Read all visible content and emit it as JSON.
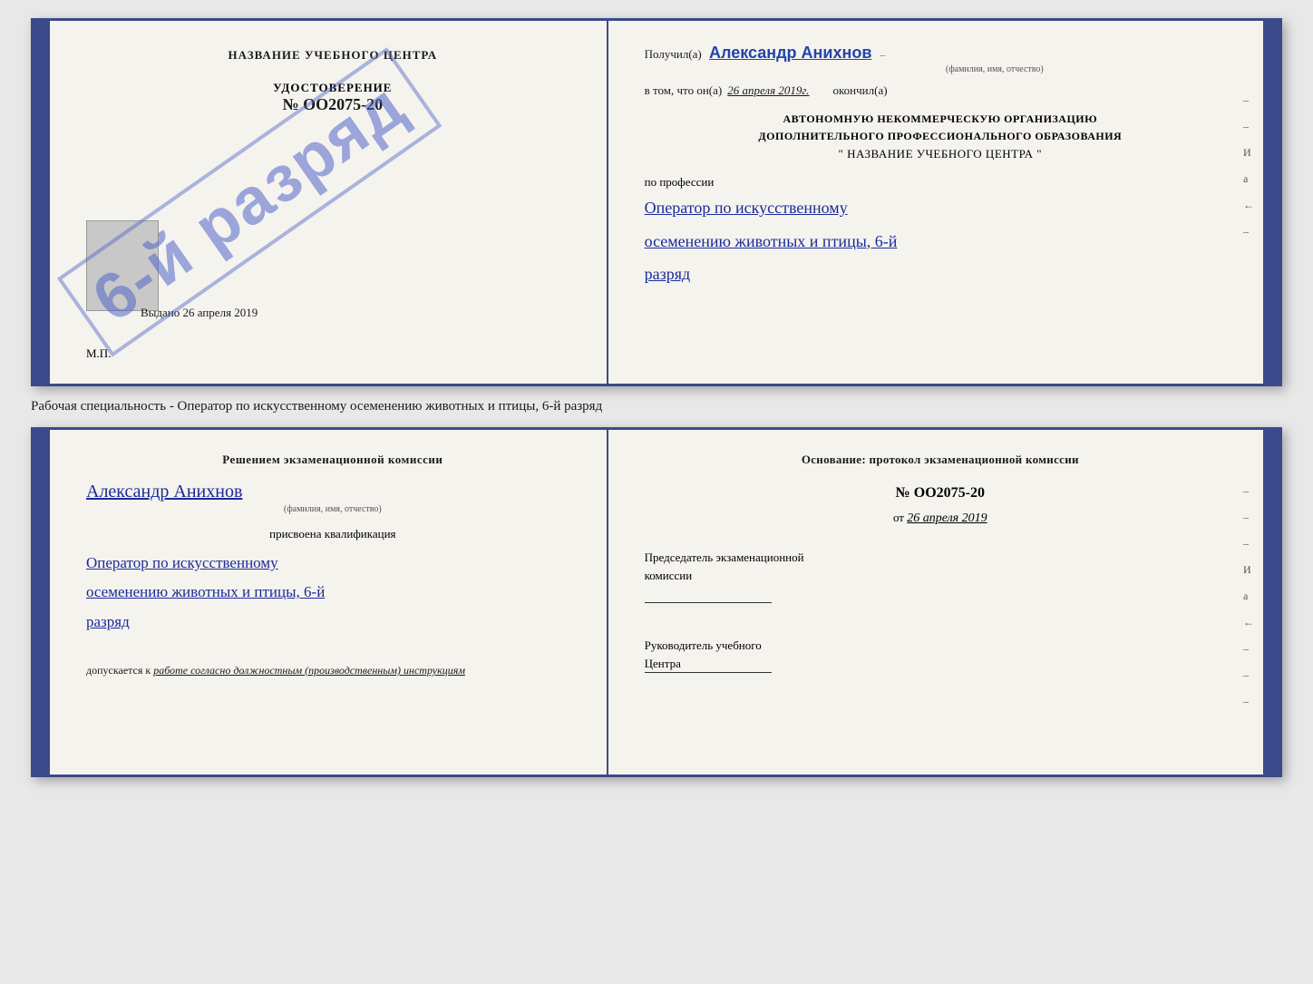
{
  "page": {
    "background": "#e8e8e8"
  },
  "top_cert": {
    "left": {
      "title": "НАЗВАНИЕ УЧЕБНОГО ЦЕНТРА",
      "udostoverenie_label": "УДОСТОВЕРЕНИЕ",
      "cert_number": "№ OO2075-20",
      "stamp_text": "6-й разряд",
      "issued_label": "Выдано",
      "issued_date": "26 апреля 2019",
      "mp_label": "М.П."
    },
    "right": {
      "received_prefix": "Получил(а)",
      "received_name": "Александр Анихнов",
      "received_name_subtitle": "(фамилия, имя, отчество)",
      "vtom_prefix": "в том, что он(а)",
      "vtom_date": "26 апреля 2019г.",
      "okonchil": "окончил(а)",
      "org_line1": "АВТОНОМНУЮ НЕКОММЕРЧЕСКУЮ ОРГАНИЗАЦИЮ",
      "org_line2": "ДОПОЛНИТЕЛЬНОГО ПРОФЕССИОНАЛЬНОГО ОБРАЗОВАНИЯ",
      "org_line3": "\" НАЗВАНИЕ УЧЕБНОГО ЦЕНТРА \"",
      "po_professii": "по профессии",
      "profession_line1": "Оператор по искусственному",
      "profession_line2": "осеменению животных и птицы, 6-й",
      "profession_line3": "разряд",
      "side_marks": [
        "–",
        "–",
        "И",
        "а",
        "←",
        "–"
      ]
    }
  },
  "specialty_label": "Рабочая специальность - Оператор по искусственному осеменению животных и птицы, 6-й разряд",
  "bottom_cert": {
    "left": {
      "resheniem": "Решением экзаменационной комиссии",
      "person_name": "Александр Анихнов",
      "person_name_subtitle": "(фамилия, имя, отчество)",
      "prisvoena": "присвоена квалификация",
      "qualification_line1": "Оператор по искусственному",
      "qualification_line2": "осеменению животных и птицы, 6-й",
      "qualification_line3": "разряд",
      "dopuskaetsya_prefix": "допускается к",
      "dopuskaetsya_text": "работе согласно должностным (производственным) инструкциям"
    },
    "right": {
      "osnovanie": "Основание: протокол экзаменационной комиссии",
      "protocol_number": "№ OO2075-20",
      "ot_prefix": "от",
      "protocol_date": "26 апреля 2019",
      "chairman_line1": "Председатель экзаменационной",
      "chairman_line2": "комиссии",
      "rukovoditel_line1": "Руководитель учебного",
      "rukovoditel_line2": "Центра",
      "side_marks": [
        "–",
        "–",
        "–",
        "И",
        "а",
        "←",
        "–",
        "–",
        "–"
      ]
    }
  }
}
